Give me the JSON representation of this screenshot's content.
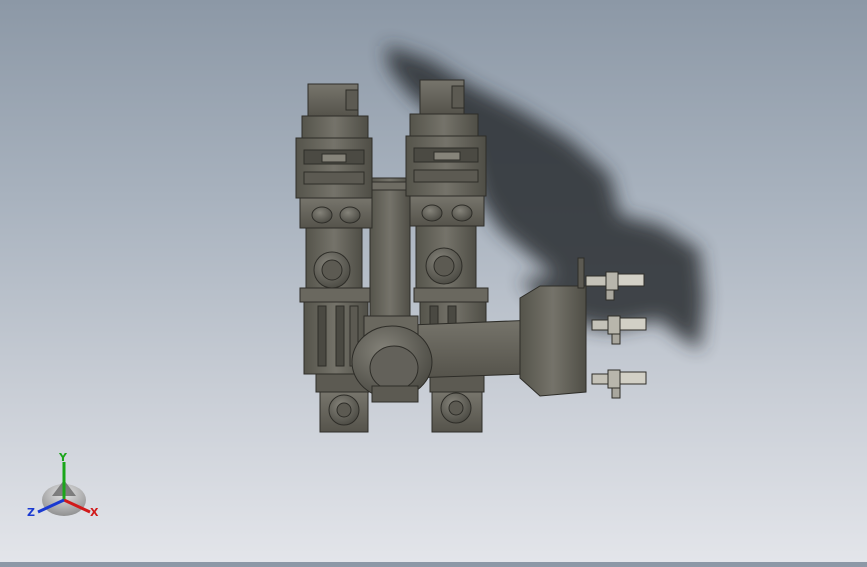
{
  "scene": {
    "view": "3d-cad-model",
    "background_top": "#8c98a6",
    "background_bottom": "#e3e5ea",
    "part_color": "#67655b",
    "shadow_color": "#2a2d33"
  },
  "triad": {
    "x_label": "X",
    "y_label": "Y",
    "z_label": "Z",
    "x_color": "#d11a1a",
    "y_color": "#1aa61a",
    "z_color": "#1a3ad1"
  }
}
